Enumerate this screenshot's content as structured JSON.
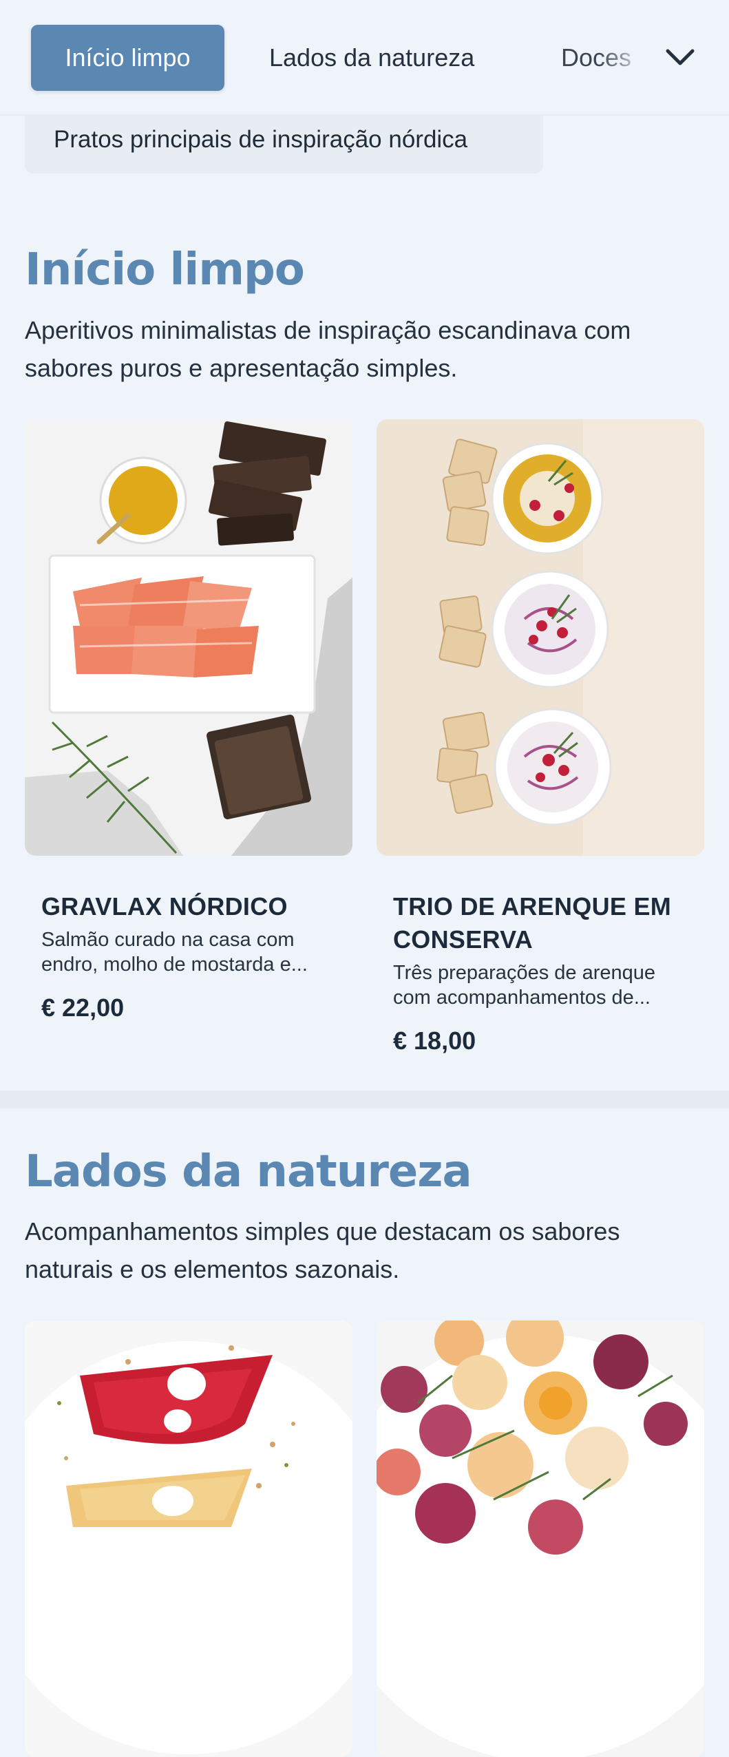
{
  "nav": {
    "tabs": [
      {
        "label": "Início limpo",
        "active": true
      },
      {
        "label": "Lados da natureza",
        "active": false
      },
      {
        "label": "Doces",
        "active": false
      }
    ],
    "more_icon": "chevron-down-icon"
  },
  "subnav": {
    "label": "Pratos principais de inspiração nórdica"
  },
  "sections": [
    {
      "title": "Início limpo",
      "description": "Aperitivos minimalistas de inspiração escandinava com sabores puros e apresentação simples.",
      "items": [
        {
          "name": "GRAVLAX NÓRDICO",
          "description": "Salmão curado na casa com endro, molho de mostarda e...",
          "price": "€ 22,00"
        },
        {
          "name": "TRIO DE ARENQUE EM CONSERVA",
          "description": "Três preparações de arenque com acompanhamentos de...",
          "price": "€ 18,00"
        }
      ]
    },
    {
      "title": "Lados da natureza",
      "description": "Acompanhamentos simples que destacam os sabores naturais e os elementos sazonais."
    }
  ],
  "colors": {
    "accent": "#5b87b3",
    "background": "#eff3fa",
    "text": "#1d2a3a"
  }
}
